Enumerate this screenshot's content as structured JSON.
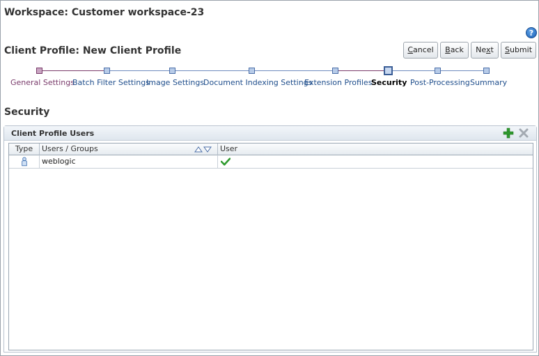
{
  "workspace": {
    "title": "Workspace: Customer workspace-23"
  },
  "help": {
    "glyph": "?"
  },
  "client_profile": {
    "title": "Client Profile: New Client Profile"
  },
  "buttons": {
    "cancel": {
      "pre": "",
      "mn": "C",
      "post": "ancel"
    },
    "back": {
      "pre": "",
      "mn": "B",
      "post": "ack"
    },
    "next": {
      "pre": "Ne",
      "mn": "x",
      "post": "t"
    },
    "submit": {
      "pre": "",
      "mn": "S",
      "post": "ubmit"
    }
  },
  "train": {
    "steps": [
      {
        "label": "General Settings",
        "state": "visited"
      },
      {
        "label": "Batch Filter Settings",
        "state": "unvisited"
      },
      {
        "label": "Image Settings",
        "state": "unvisited"
      },
      {
        "label": "Document Indexing Settings",
        "state": "unvisited"
      },
      {
        "label": "Extension Profiles",
        "state": "unvisited"
      },
      {
        "label": "Security",
        "state": "current"
      },
      {
        "label": "Post-Processing",
        "state": "unvisited"
      },
      {
        "label": "Summary",
        "state": "unvisited"
      }
    ]
  },
  "section": {
    "title": "Security"
  },
  "panel": {
    "title": "Client Profile Users",
    "add_icon": "add-icon",
    "delete_icon": "delete-icon"
  },
  "table": {
    "columns": [
      "Type",
      "Users / Groups",
      "User"
    ],
    "rows": [
      {
        "type_icon": "user-icon",
        "name": "weblogic",
        "user": true
      }
    ]
  },
  "colors": {
    "visited": "#7a3b6b",
    "link": "#1f4e8c",
    "check": "#2e9a2e",
    "add": "#2e9a2e"
  }
}
